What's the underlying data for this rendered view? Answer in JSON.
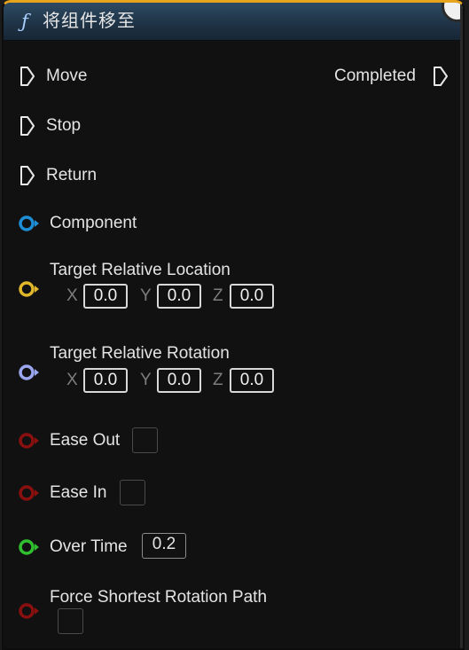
{
  "node": {
    "title": "将组件移至",
    "func_icon_glyph": "ƒ",
    "header_color": "#1f3447",
    "accent_color": "#e8a51c"
  },
  "exec_inputs": [
    {
      "label": "Move"
    },
    {
      "label": "Stop"
    },
    {
      "label": "Return"
    }
  ],
  "exec_outputs": [
    {
      "label": "Completed"
    }
  ],
  "pins": {
    "component": {
      "label": "Component",
      "color": "#1e8fd6"
    },
    "target_location": {
      "label": "Target Relative Location",
      "color": "#e0b72a",
      "x_label": "X",
      "x_value": "0.0",
      "y_label": "Y",
      "y_value": "0.0",
      "z_label": "Z",
      "z_value": "0.0"
    },
    "target_rotation": {
      "label": "Target Relative Rotation",
      "color": "#9aa6ef",
      "x_label": "X",
      "x_value": "0.0",
      "y_label": "Y",
      "y_value": "0.0",
      "z_label": "Z",
      "z_value": "0.0"
    },
    "ease_out": {
      "label": "Ease Out",
      "color": "#8a1010",
      "checked": false
    },
    "ease_in": {
      "label": "Ease In",
      "color": "#8a1010",
      "checked": false
    },
    "over_time": {
      "label": "Over Time",
      "color": "#2fbf2f",
      "value": "0.2"
    },
    "force_shortest": {
      "label": "Force Shortest Rotation Path",
      "color": "#8a1010",
      "checked": false
    }
  }
}
